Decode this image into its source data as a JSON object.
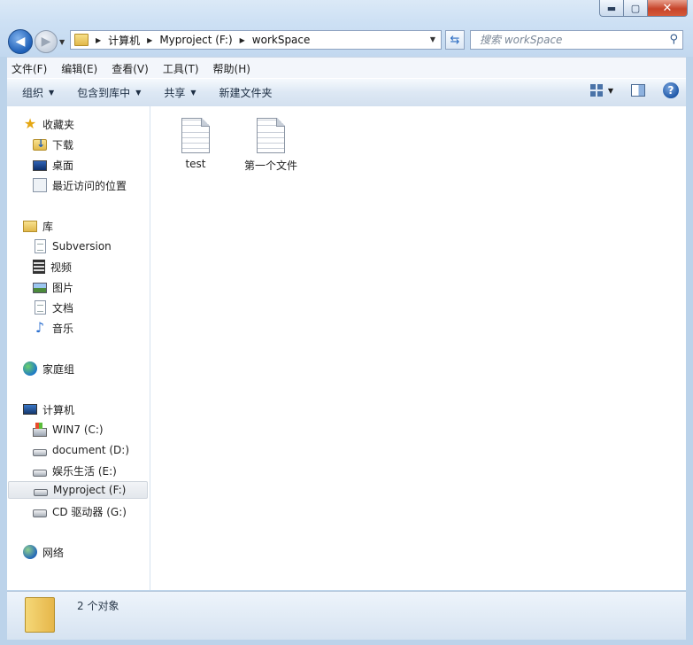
{
  "window": {
    "controls": {
      "minimize": "▬",
      "maximize": "▢",
      "close": "✕"
    }
  },
  "address": {
    "crumbs": [
      "计算机",
      "Myproject (F:)",
      "workSpace"
    ]
  },
  "search": {
    "placeholder": "搜索 workSpace"
  },
  "menu": [
    "文件(F)",
    "编辑(E)",
    "查看(V)",
    "工具(T)",
    "帮助(H)"
  ],
  "commands": {
    "organize": "组织",
    "include_library": "包含到库中",
    "share": "共享",
    "new_folder": "新建文件夹",
    "help": "?"
  },
  "nav": {
    "favorites": {
      "label": "收藏夹",
      "items": [
        "下载",
        "桌面",
        "最近访问的位置"
      ]
    },
    "libraries": {
      "label": "库",
      "items": [
        "Subversion",
        "视频",
        "图片",
        "文档",
        "音乐"
      ]
    },
    "homegroup": {
      "label": "家庭组"
    },
    "computer": {
      "label": "计算机",
      "items": [
        "WIN7 (C:)",
        "document (D:)",
        "娱乐生活  (E:)",
        "Myproject (F:)",
        "CD 驱动器 (G:)"
      ],
      "selected": "Myproject (F:)"
    },
    "network": {
      "label": "网络"
    }
  },
  "files": [
    {
      "name": "test",
      "icon": "text-file-icon"
    },
    {
      "name": "第一个文件",
      "icon": "text-file-icon"
    }
  ],
  "status": {
    "count": "2 个对象"
  },
  "colors": {
    "selected_bg": "#e3e7ec",
    "accent": "#1e5fb7",
    "close_btn": "#c7442a"
  }
}
